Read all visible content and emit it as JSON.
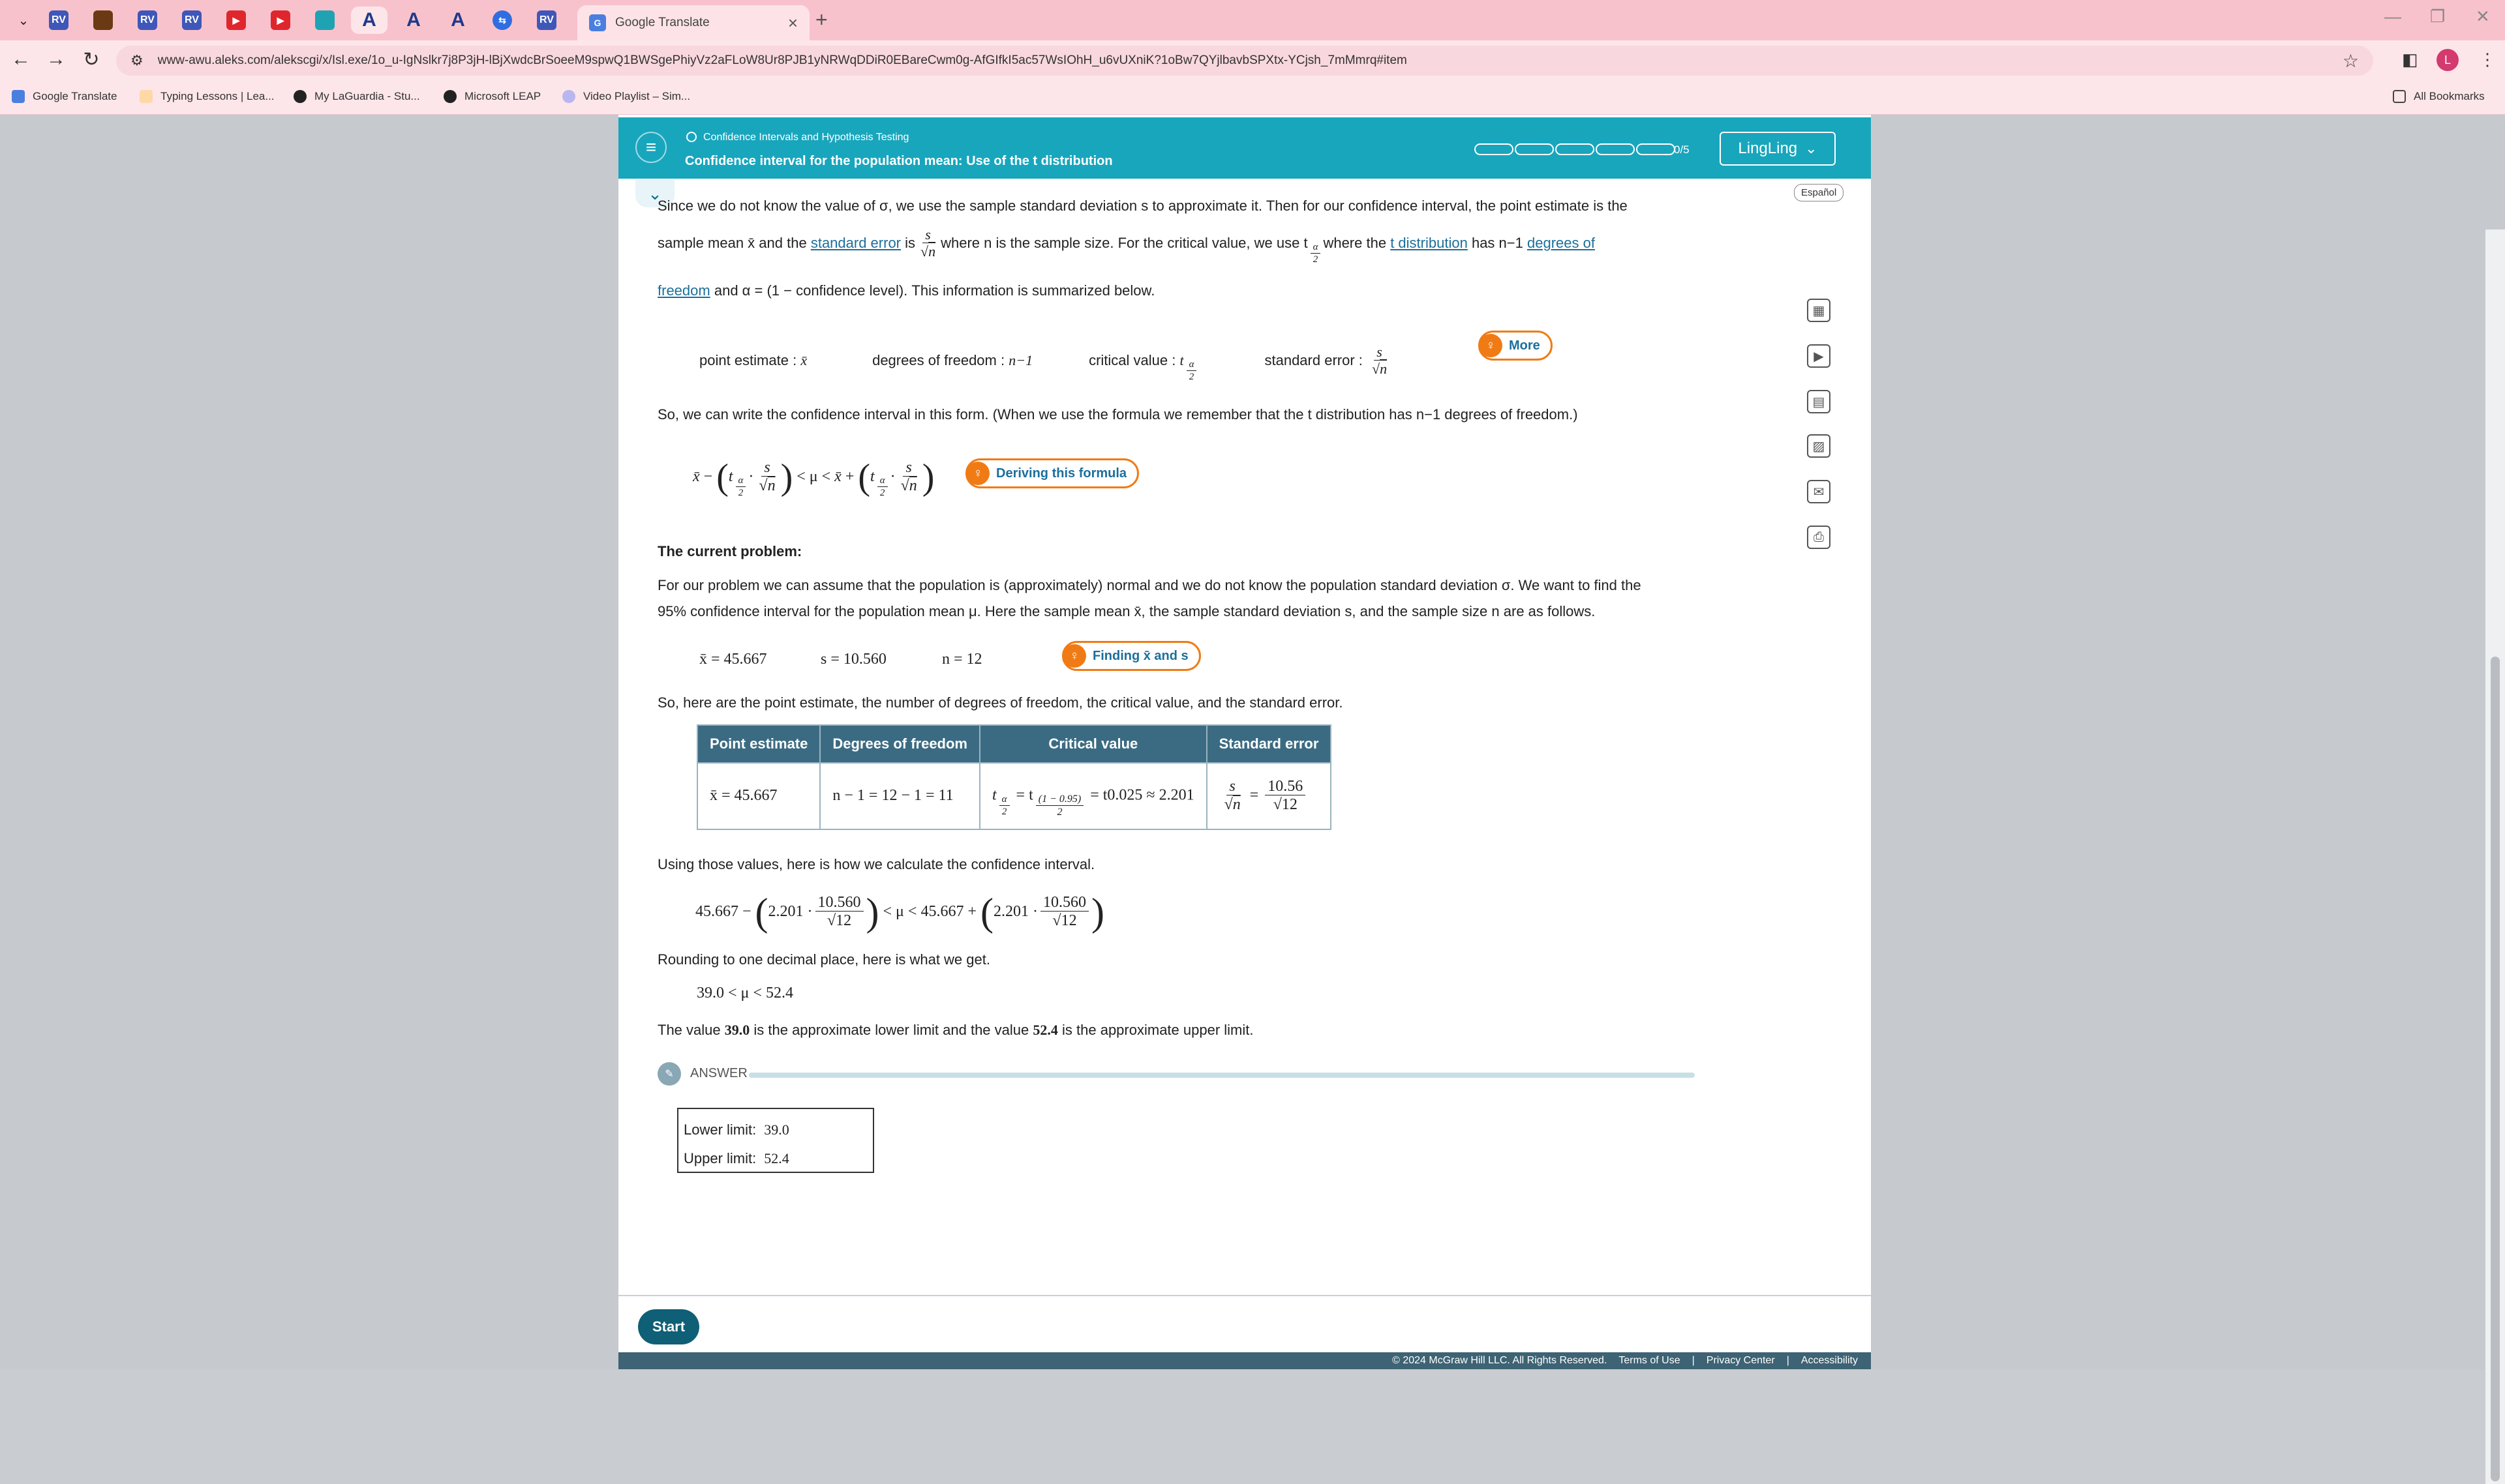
{
  "browser": {
    "active_tab_title": "Google Translate",
    "url": "www-awu.aleks.com/alekscgi/x/Isl.exe/1o_u-IgNslkr7j8P3jH-lBjXwdcBrSoeeM9spwQ1BWSgePhiyVz2aFLoW8Ur8PJB1yNRWqDDiR0EBareCwm0g-AfGIfkI5ac57WsIOhH_u6vUXniK?1oBw7QYjlbavbSPXtx-YCjsh_7mMmrq#item",
    "bookmarks": [
      "Google Translate",
      "Typing Lessons | Lea...",
      "My LaGuardia - Stu...",
      "Microsoft LEAP",
      "Video Playlist – Sim..."
    ],
    "all_bookmarks": "All Bookmarks",
    "avatar_letter": "L"
  },
  "header": {
    "topic": "Confidence Intervals and Hypothesis Testing",
    "subtopic": "Confidence interval for the population mean: Use of the t distribution",
    "progress": "0/5",
    "user": "LingLing"
  },
  "espanol": "Español",
  "text": {
    "p1a": "Since we do not know the value of σ, we use the sample standard deviation s to approximate it. Then for our confidence interval, the point estimate is the",
    "p2a": "sample mean x̄ and the",
    "standard_error_link": "standard error",
    "p2b": "is",
    "p2c": "where n is the sample size. For the critical value, we use t",
    "p2d": "where the",
    "t_dist_link": "t distribution",
    "p2e": "has n−1",
    "degrees_link_1": "degrees of",
    "degrees_link_2": "freedom",
    "p3": "and α = (1 − confidence level). This information is summarized below.",
    "pe_label": "point estimate :",
    "df_label": "degrees of freedom :",
    "df_value": "n−1",
    "cv_label": "critical value :",
    "se_label": "standard error :",
    "more": "More",
    "p4": "So, we can write the confidence interval in this form. (When we use the formula we remember that the t distribution has n−1 degrees of freedom.)",
    "deriving": "Deriving this formula",
    "current_heading": "The current problem:",
    "p5a": "For our problem we can assume that the population is (approximately) normal and we do not know the population standard deviation σ. We want to find the",
    "p5b": "95% confidence interval for the population mean μ. Here the sample mean x̄, the sample standard deviation s, and the sample size n are as follows.",
    "xbar_val": "x̄ = 45.667",
    "s_val": "s = 10.560",
    "n_val": "n = 12",
    "finding": "Finding x̄ and s",
    "p6": "So, here are the point estimate, the number of degrees of freedom, the critical value, and the standard error.",
    "p7": "Using those values, here is how we calculate the confidence interval.",
    "p8": "Rounding to one decimal place, here is what we get.",
    "result": "39.0 < μ < 52.4",
    "p9a": "The value",
    "lower_bold": "39.0",
    "p9b": "is the approximate lower limit and the value",
    "upper_bold": "52.4",
    "p9c": "is the approximate upper limit."
  },
  "table": {
    "headers": [
      "Point estimate",
      "Degrees of freedom",
      "Critical value",
      "Standard error"
    ],
    "point_estimate": "x̄ = 45.667",
    "degrees_of_freedom": "n − 1 = 12 − 1 = 11",
    "critical_value_tail": "= t0.025 ≈ 2.201",
    "standard_error_tail": "10.56",
    "standard_error_den": "√12"
  },
  "answer": {
    "label": "ANSWER",
    "lower_label": "Lower limit:",
    "lower_value": "39.0",
    "upper_label": "Upper limit:",
    "upper_value": "52.4"
  },
  "start": "Start",
  "footer": [
    "© 2024 McGraw Hill LLC. All Rights Reserved.",
    "Terms of Use",
    "Privacy Center",
    "Accessibility"
  ]
}
